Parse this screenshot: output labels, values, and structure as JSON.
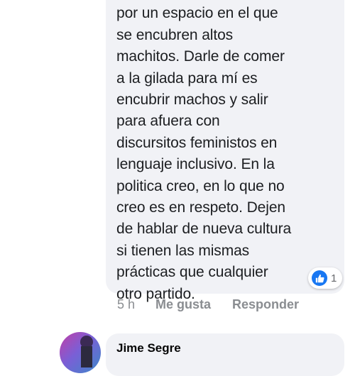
{
  "comment": {
    "text": "por haber puesto la cara\npor un espacio en el que\nse encubren altos\nmachitos. Darle de comer\na la gilada para mí es\nencubrir machos y salir\npara afuera con\ndiscursitos feministos en\nlenguaje inclusivo. En la\npolitica creo, en lo que no\ncreo es en respeto. Dejen\nde hablar de nueva cultura\nsi tienen las mismas\nprácticas que cualquier\notro partido.",
    "reaction_icon": "like-icon",
    "reaction_count": "1",
    "time": "5 h",
    "like_label": "Me gusta",
    "reply_label": "Responder"
  },
  "next_comment": {
    "author": "Jime Segre"
  },
  "colors": {
    "bubble": "#f1f2f6",
    "text": "#1c1e21",
    "meta": "#8a8d91",
    "like_blue": "#1877f2"
  }
}
